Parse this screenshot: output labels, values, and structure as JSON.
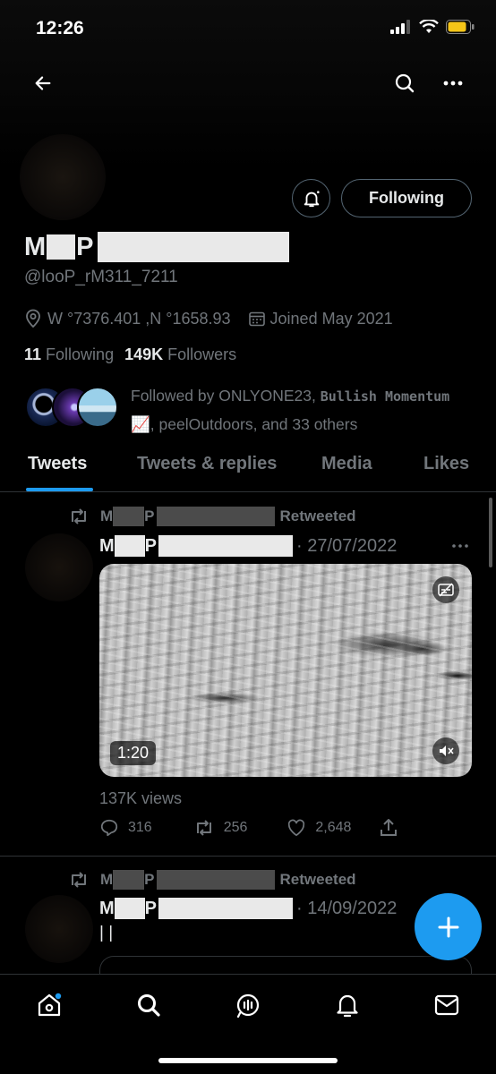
{
  "status_bar": {
    "time": "12:26"
  },
  "profile": {
    "name_initial": "M",
    "name_second": "P",
    "handle": "@looP_rM311_7211",
    "location": "W °7376.401 ,N °1658.93",
    "joined": "Joined May 2021",
    "following_count": "11",
    "following_label": "Following",
    "followers_count": "149K",
    "followers_label": "Followers",
    "follow_button": "Following",
    "followed_by_prefix": "Followed by ONLYONE23, ",
    "followed_by_bold": "Bullish Momentum",
    "followed_by_emoji": "📈",
    "followed_by_rest": ", peelOutdoors, and 33 others"
  },
  "tabs": [
    {
      "label": "Tweets",
      "active": true
    },
    {
      "label": "Tweets & replies",
      "active": false
    },
    {
      "label": "Media",
      "active": false
    },
    {
      "label": "Likes",
      "active": false
    }
  ],
  "tweets": [
    {
      "retweet_label": "Retweeted",
      "author_initial": "M",
      "author_second": "P",
      "date": "· 27/07/2022",
      "video_duration": "1:20",
      "views": "137K views",
      "replies": "316",
      "retweets": "256",
      "likes": "2,648"
    },
    {
      "retweet_label": "Retweeted",
      "author_initial": "M",
      "author_second": "P",
      "date": "· 14/09/2022",
      "body": "| |"
    }
  ],
  "colors": {
    "accent": "#1d9bf0",
    "muted": "#71767b",
    "text": "#e7e9ea",
    "border": "#2f3336"
  },
  "icons": [
    "back-arrow-icon",
    "search-icon",
    "more-icon",
    "bell-icon",
    "location-icon",
    "calendar-icon",
    "retweet-icon",
    "reply-icon",
    "like-icon",
    "share-icon",
    "mute-icon",
    "home-icon",
    "spaces-icon",
    "notifications-icon",
    "messages-icon",
    "compose-icon"
  ]
}
